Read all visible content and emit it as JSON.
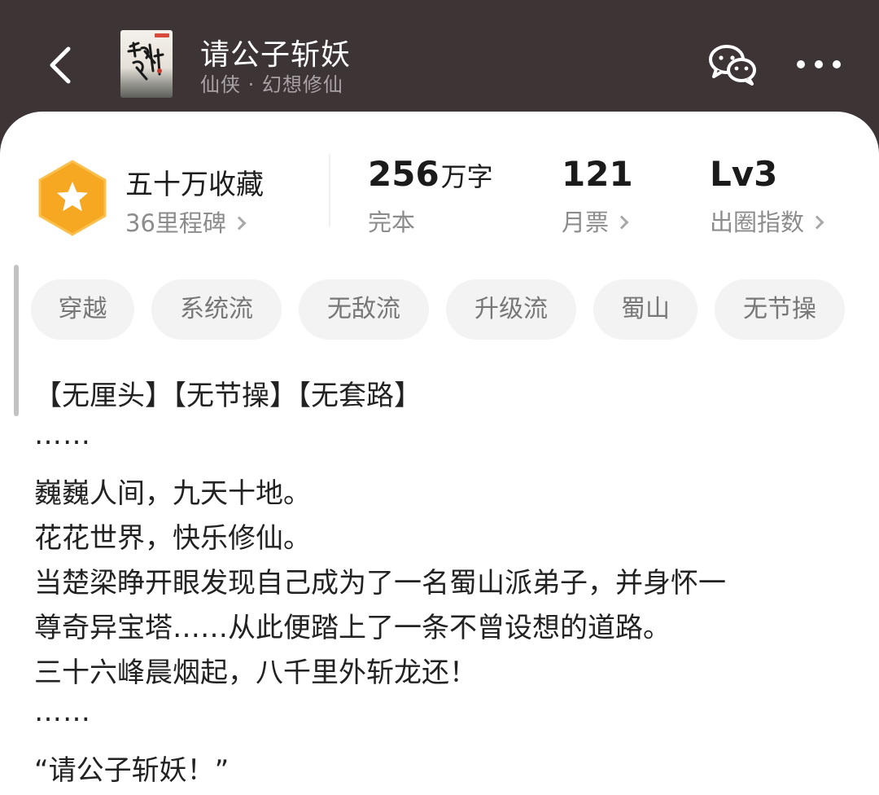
{
  "header": {
    "back_icon": "chevron-left-icon",
    "title": "请公子斩妖",
    "subtitle": "仙侠 · 幻想修仙",
    "share_icon": "wechat-icon",
    "more_icon": "more-dots-icon"
  },
  "stats": {
    "collection": {
      "title": "五十万收藏",
      "milestone": "36里程碑",
      "icon": "star-hexagon-icon"
    },
    "words": {
      "value": "256",
      "unit": "万字",
      "label": "完本"
    },
    "monthly": {
      "value": "121",
      "label": "月票"
    },
    "level": {
      "value": "Lv3",
      "label": "出圈指数"
    }
  },
  "tags": [
    "穿越",
    "系统流",
    "无敌流",
    "升级流",
    "蜀山",
    "无节操"
  ],
  "synopsis": {
    "lines": [
      "【无厘头】【无节操】【无套路】",
      "……",
      "巍巍人间，九天十地。",
      "花花世界，快乐修仙。",
      "当楚梁睁开眼发现自己成为了一名蜀山派弟子，并身怀一",
      "尊奇异宝塔……从此便踏上了一条不曾设想的道路。",
      "三十六峰晨烟起，八千里外斩龙还！",
      "……",
      "“请公子斩妖！”"
    ]
  },
  "colors": {
    "header_bg": "#3d3436",
    "accent_orange": "#f7a823",
    "tag_bg": "#f3f3f3"
  }
}
